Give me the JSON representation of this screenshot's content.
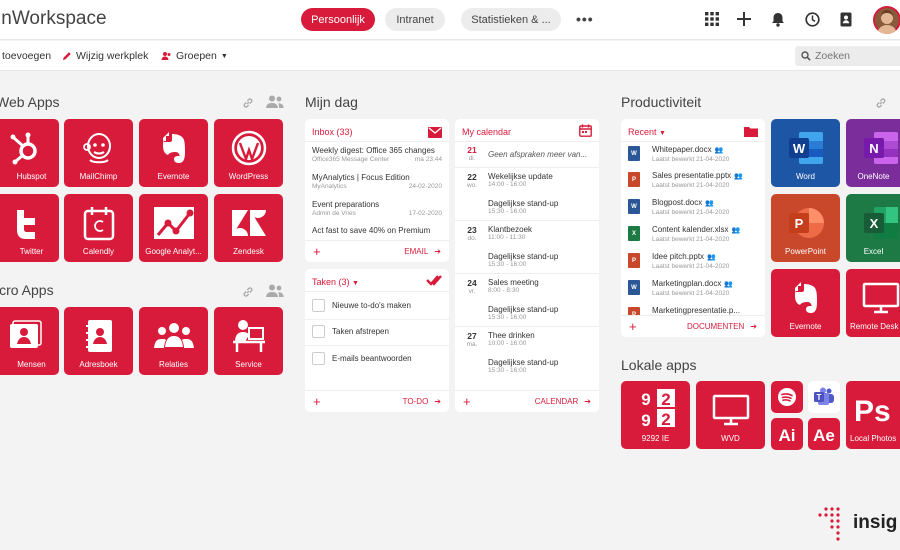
{
  "topbar": {
    "title": "InWorkspace",
    "tabs": [
      {
        "label": "Persoonlijk",
        "active": true
      },
      {
        "label": "Intranet",
        "active": false
      },
      {
        "label": "Statistieken & ...",
        "active": false
      }
    ],
    "more": "•••",
    "icons": [
      "grid-icon",
      "plus-icon",
      "bell-icon",
      "clock-icon",
      "contacts-icon",
      "avatar"
    ]
  },
  "subbar": {
    "add_label": "toevoegen",
    "edit_label": "Wijzig werkplek",
    "groups_label": "Groepen",
    "search_placeholder": "Zoeken"
  },
  "web_apps": {
    "title": "Web Apps",
    "tiles": [
      "Hubspot",
      "MailChimp",
      "Evernote",
      "WordPress",
      "Twitter",
      "Calendly",
      "Google Analyt...",
      "Zendesk"
    ]
  },
  "micro_apps": {
    "title": "icro Apps",
    "tiles": [
      "Mensen",
      "Adresboek",
      "Relaties",
      "Service"
    ]
  },
  "mijn_dag": {
    "title": "Mijn dag",
    "inbox": {
      "title": "Inbox (33)",
      "items": [
        {
          "subject": "Weekly digest: Office 365 changes",
          "from": "Office365 Message Center",
          "date": "ma 23:44"
        },
        {
          "subject": "MyAnalytics | Focus Edition",
          "from": "MyAnalytics",
          "date": "24-02-2020"
        },
        {
          "subject": "Event preparations",
          "from": "Admin de Vries",
          "date": "17-02-2020"
        },
        {
          "subject": "Act fast to save 40% on Premium",
          "from": "",
          "date": ""
        }
      ],
      "footer": "EMAIL"
    },
    "tasks": {
      "title": "Taken (3)",
      "items": [
        "Nieuwe to-do's maken",
        "Taken afstrepen",
        "E-mails beantwoorden"
      ],
      "footer": "TO-DO"
    },
    "calendar": {
      "title": "My calendar",
      "rows": [
        {
          "day": "21",
          "weekday": "di.",
          "events": [
            {
              "title": "Geen afspraken meer van...",
              "time": ""
            }
          ]
        },
        {
          "day": "22",
          "weekday": "wo.",
          "events": [
            {
              "title": "Wekelijkse update",
              "time": "14:00 - 16:00"
            },
            {
              "title": "Dagelijkse stand-up",
              "time": "15:30 - 16:00"
            }
          ]
        },
        {
          "day": "23",
          "weekday": "do.",
          "events": [
            {
              "title": "Klantbezoek",
              "time": "11:00 - 11:30"
            },
            {
              "title": "Dagelijkse stand-up",
              "time": "15:30 - 16:00"
            }
          ]
        },
        {
          "day": "24",
          "weekday": "vr.",
          "events": [
            {
              "title": "Sales meeting",
              "time": "8:00 - 8:30"
            },
            {
              "title": "Dagelijkse stand-up",
              "time": "15:30 - 16:00"
            }
          ]
        },
        {
          "day": "27",
          "weekday": "ma.",
          "events": [
            {
              "title": "Thee drinken",
              "time": "10:00 - 16:00"
            },
            {
              "title": "Dagelijkse stand-up",
              "time": "15:30 - 16:00"
            }
          ]
        }
      ],
      "footer": "CALENDAR"
    }
  },
  "productiviteit": {
    "title": "Productiviteit",
    "recent": {
      "title": "Recent",
      "docs": [
        {
          "name": "Whitepaper.docx",
          "edited": "Laatst bewerkt 21-04-2020",
          "type": "word"
        },
        {
          "name": "Sales presentatie.pptx",
          "edited": "Laatst bewerkt 21-04-2020",
          "type": "ppt"
        },
        {
          "name": "Blogpost.docx",
          "edited": "Laatst bewerkt 21-04-2020",
          "type": "word"
        },
        {
          "name": "Content kalender.xlsx",
          "edited": "Laatst bewerkt 21-04-2020",
          "type": "excel"
        },
        {
          "name": "Idee pitch.pptx",
          "edited": "Laatst bewerkt 21-04-2020",
          "type": "ppt"
        },
        {
          "name": "Marketingplan.docx",
          "edited": "Laatst bewerkt 21-04-2020",
          "type": "word"
        },
        {
          "name": "Marketingpresentatie.p...",
          "edited": "",
          "type": "ppt"
        }
      ],
      "footer": "DOCUMENTEN"
    },
    "tiles": [
      "Word",
      "OneNote",
      "PowerPoint",
      "Excel",
      "Evernote",
      "Remote Desk"
    ]
  },
  "lokale_apps": {
    "title": "Lokale apps",
    "tiles": [
      "9292 IE",
      "WVD",
      "Local Photos"
    ]
  },
  "brand": {
    "accent": "#d81b3a",
    "logo_text": "insig"
  }
}
